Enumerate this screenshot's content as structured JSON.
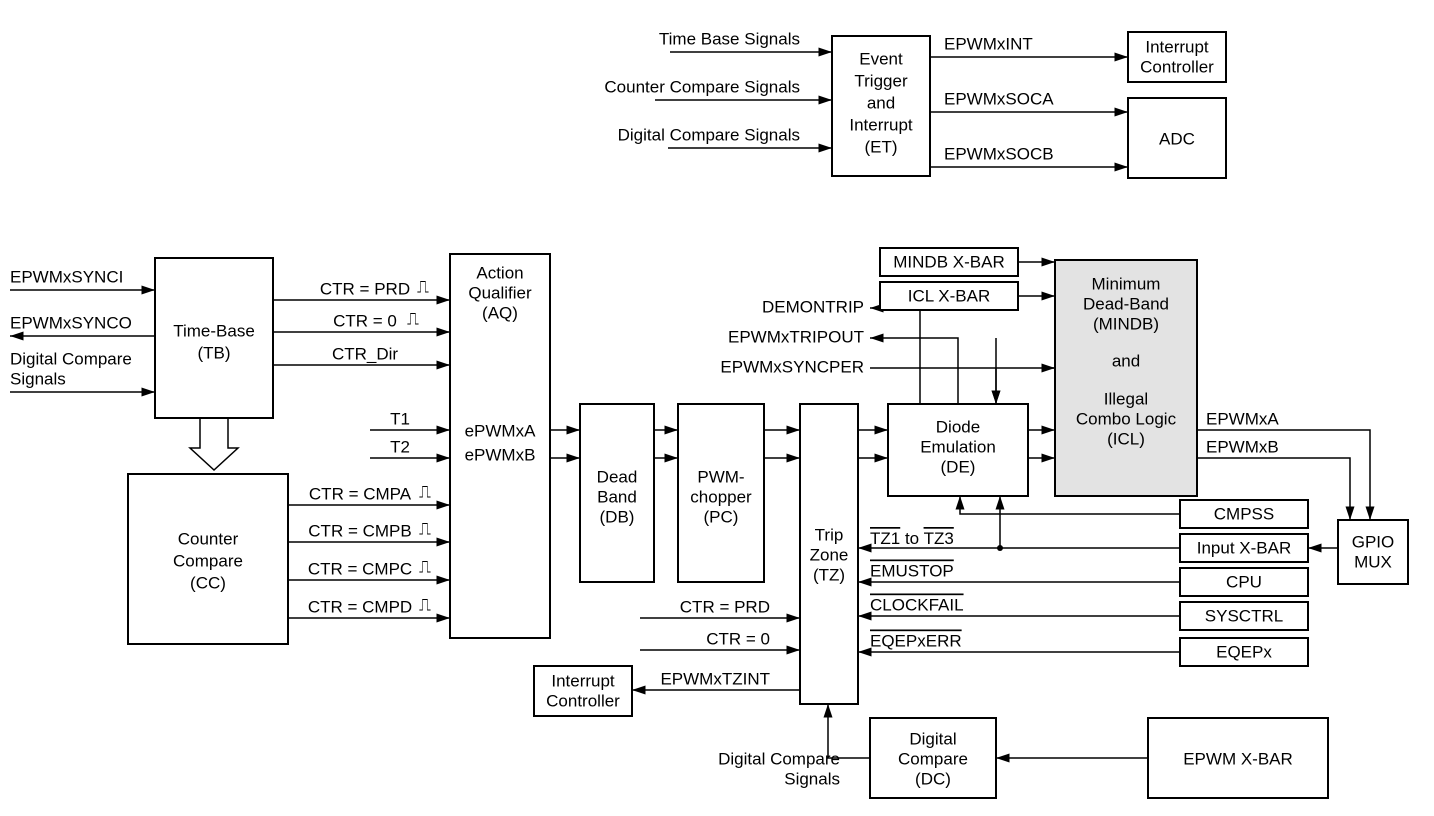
{
  "top": {
    "inputs": {
      "timeBase": "Time Base Signals",
      "counterCompare": "Counter Compare Signals",
      "digitalCompare": "Digital Compare Signals"
    },
    "et": {
      "l1": "Event",
      "l2": "Trigger",
      "l3": "and",
      "l4": "Interrupt",
      "l5": "(ET)"
    },
    "out": {
      "int": "EPWMxINT",
      "soca": "EPWMxSOCA",
      "socb": "EPWMxSOCB"
    },
    "intCtrl": {
      "l1": "Interrupt",
      "l2": "Controller"
    },
    "adc": "ADC"
  },
  "left": {
    "synci": "EPWMxSYNCI",
    "synco": "EPWMxSYNCO",
    "dc": {
      "l1": "Digital Compare",
      "l2": "Signals"
    }
  },
  "tb": {
    "l1": "Time-Base",
    "l2": "(TB)"
  },
  "cc": {
    "l1": "Counter",
    "l2": "Compare",
    "l3": "(CC)"
  },
  "aq": {
    "l1": "Action",
    "l2": "Qualifier",
    "l3": "(AQ)",
    "a": "ePWMxA",
    "b": "ePWMxB"
  },
  "tbSig": {
    "prd": "CTR = PRD",
    "zero": "CTR = 0",
    "dir": "CTR_Dir"
  },
  "ccSig": {
    "a": "CTR = CMPA",
    "b": "CTR = CMPB",
    "c": "CTR = CMPC",
    "d": "CTR = CMPD"
  },
  "t": {
    "t1": "T1",
    "t2": "T2"
  },
  "db": {
    "l1": "Dead",
    "l2": "Band",
    "l3": "(DB)"
  },
  "pc": {
    "l1": "PWM-",
    "l2": "chopper",
    "l3": "(PC)"
  },
  "tz": {
    "l1": "Trip",
    "l2": "Zone",
    "l3": "(TZ)"
  },
  "de": {
    "l1": "Diode",
    "l2": "Emulation",
    "l3": "(DE)"
  },
  "mindb": {
    "l1": "Minimum",
    "l2": "Dead-Band",
    "l3": "(MINDB)",
    "l4": "and",
    "l5": "Illegal",
    "l6": "Combo Logic",
    "l7": "(ICL)"
  },
  "xbars": {
    "mindb": "MINDB X-BAR",
    "icl": "ICL X-BAR"
  },
  "upSig": {
    "demon": "DEMONTRIP",
    "tripout": "EPWMxTRIPOUT",
    "syncper": "EPWMxSYNCPER"
  },
  "outSig": {
    "a": "EPWMxA",
    "b": "EPWMxB"
  },
  "gpio": {
    "l1": "GPIO",
    "l2": "MUX"
  },
  "right": {
    "cmpss": "CMPSS",
    "inputxbar": "Input X-BAR",
    "cpu": "CPU",
    "sysctrl": "SYSCTRL",
    "eqep": "EQEPx",
    "epwmxbar": "EPWM X-BAR"
  },
  "tzSig": {
    "tz1a": "TZ1",
    "tz1b": " to ",
    "tz1c": "TZ3",
    "emu": "EMUSTOP",
    "clk": "CLOCKFAIL",
    "eqep": "EQEPxERR",
    "prd": "CTR = PRD",
    "zero": "CTR = 0",
    "tzint": "EPWMxTZINT"
  },
  "intCtrl2": {
    "l1": "Interrupt",
    "l2": "Controller"
  },
  "dc2": {
    "l1": "Digital",
    "l2": "Compare",
    "l3": "(DC)"
  },
  "dcSig": {
    "l1": "Digital Compare",
    "l2": "Signals"
  },
  "pulse": "⎍"
}
